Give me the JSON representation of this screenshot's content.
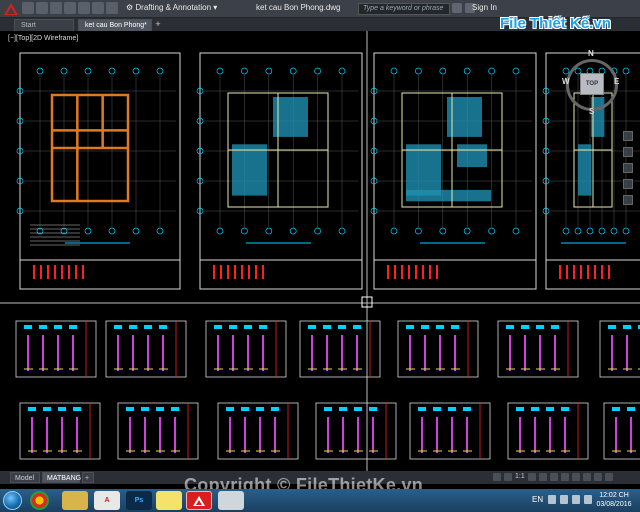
{
  "titlebar": {
    "workspace": "Drafting & Annotation",
    "document_title": "ket cau Bon Phong.dwg",
    "search_placeholder": "Type a keyword or phrase",
    "signin": "Sign In"
  },
  "tabs": [
    {
      "label": "Start"
    },
    {
      "label": "ket cau Bon Phong*"
    }
  ],
  "logo": {
    "text": "File Thiết Kế.vn"
  },
  "viewport": {
    "label": "[−][Top][2D Wireframe]"
  },
  "viewcube": {
    "top": "TOP",
    "north": "N",
    "south": "S",
    "east": "E",
    "west": "W"
  },
  "layout_tabs": [
    {
      "label": "Model"
    },
    {
      "label": "MATBANG"
    }
  ],
  "status": {
    "scale": "1:1"
  },
  "watermark": "Copyright © FileThietKe.vn",
  "taskbar": {
    "apps": [
      "chrome",
      "explorer",
      "autocad-ws",
      "photoshop",
      "notes",
      "autocad",
      "misc"
    ],
    "lang": "EN",
    "time": "12:02 CH",
    "date": "03/08/2016"
  },
  "colors": {
    "canvas": "#000000",
    "frame_red": "#ff2020",
    "frame_white": "#d8d8d8",
    "beam_orange": "#e07a20",
    "room_cyan": "#1f8fb0",
    "column_magenta": "#d040e0",
    "axis_cyan": "#00d0ff",
    "taskbar": "#1b3f60"
  }
}
